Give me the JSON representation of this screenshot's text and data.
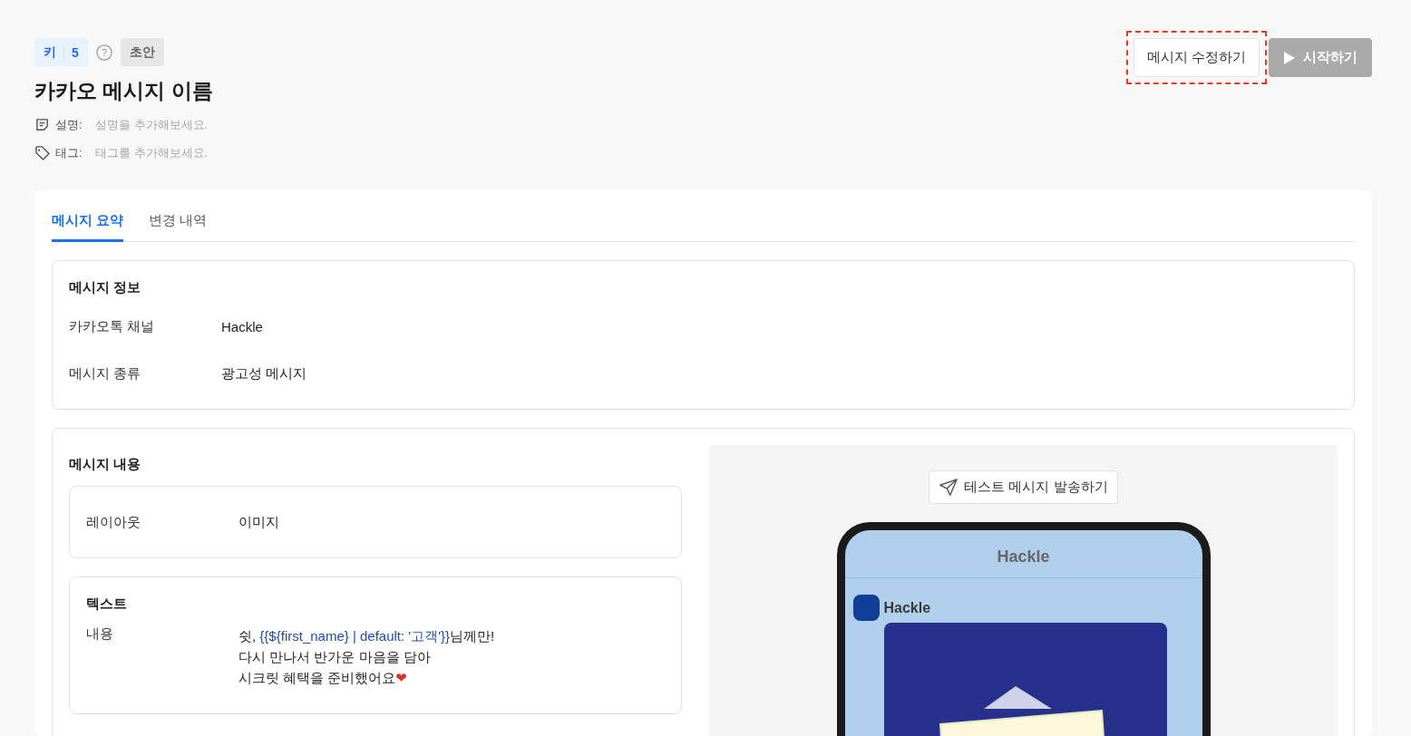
{
  "header": {
    "key_badge": {
      "label": "키",
      "value": "5"
    },
    "help": "?",
    "status_badge": "초안",
    "title": "카카오 메시지 이름",
    "meta": [
      {
        "kind": "description",
        "label": "설명:",
        "placeholder": "설명을 추가해보세요."
      },
      {
        "kind": "tag",
        "label": "태그:",
        "placeholder": "태그를 추가해보세요."
      }
    ],
    "buttons": [
      {
        "kind": "edit",
        "label": "메시지 수정하기",
        "highlighted": true,
        "disabled": false
      },
      {
        "kind": "start",
        "label": "시작하기",
        "highlighted": false,
        "disabled": true
      }
    ]
  },
  "tabs": [
    {
      "label": "메시지 요약",
      "selected": true
    },
    {
      "label": "변경 내역",
      "selected": false
    }
  ],
  "message_info": {
    "title": "메시지 정보",
    "rows": [
      {
        "label": "카카오톡 채널",
        "value": "Hackle"
      },
      {
        "label": "메시지 종류",
        "value": "광고성 메시지"
      }
    ]
  },
  "message_content": {
    "title": "메시지 내용",
    "layout": {
      "label": "레이아웃",
      "value": "이미지"
    },
    "text_section": {
      "title": "텍스트",
      "label": "내용",
      "lines": [
        [
          {
            "kind": "plain",
            "text": "쉿, "
          },
          {
            "kind": "variable",
            "text": "{{${first_name} | default: '고객'}}"
          },
          {
            "kind": "plain",
            "text": "님께만!"
          }
        ],
        [
          {
            "kind": "plain",
            "text": "다시 만나서 반가운 마음을 담아"
          }
        ],
        [
          {
            "kind": "plain",
            "text": "시크릿 혜택을 준비했어요"
          },
          {
            "kind": "emoji",
            "text": "❤"
          }
        ]
      ]
    }
  },
  "preview": {
    "test_button": "테스트 메시지 발송하기",
    "chat_title": "Hackle",
    "sender": "Hackle"
  }
}
